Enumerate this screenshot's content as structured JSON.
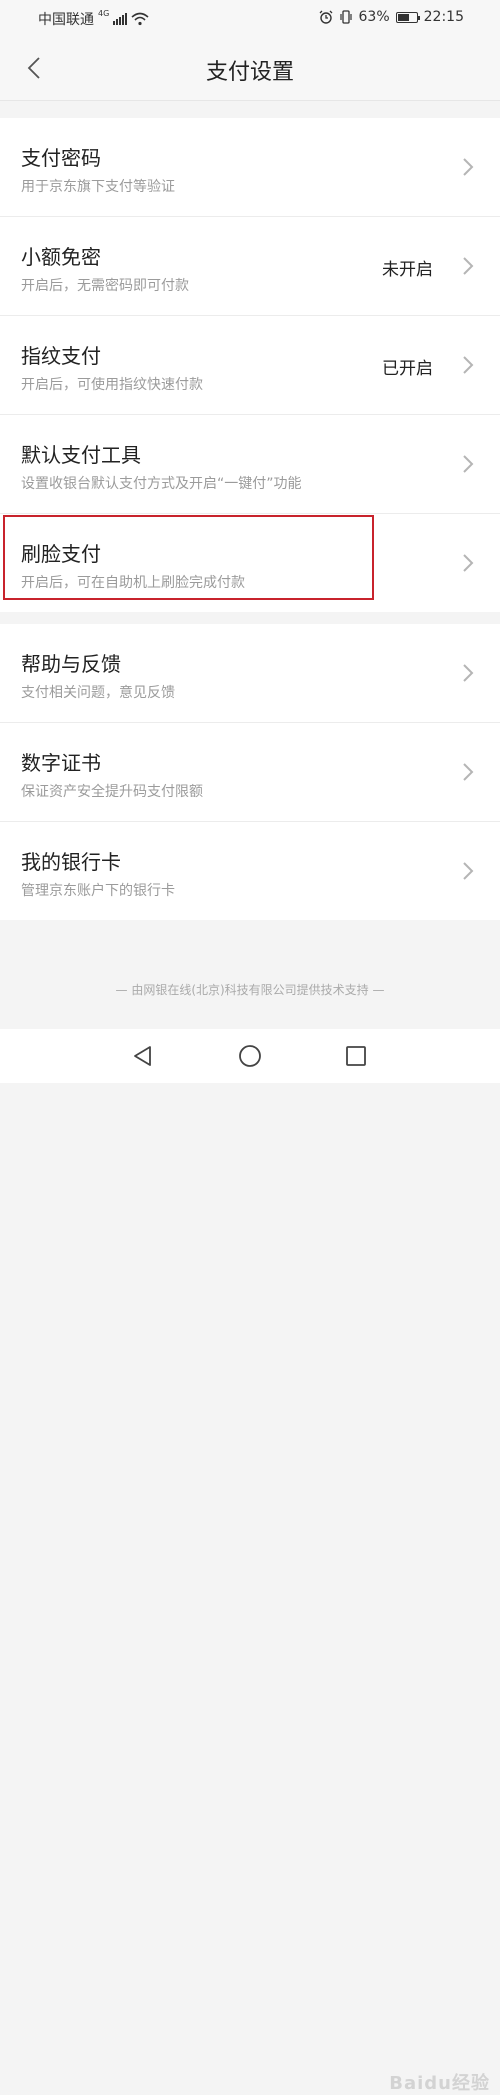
{
  "status": {
    "carrier": "中国联通",
    "network": "4G",
    "battery": "63%",
    "battery_level": 0.63,
    "time": "22:15"
  },
  "header": {
    "title": "支付设置"
  },
  "groups": [
    {
      "items": [
        {
          "title": "支付密码",
          "subtitle": "用于京东旗下支付等验证",
          "value": ""
        },
        {
          "title": "小额免密",
          "subtitle": "开启后，无需密码即可付款",
          "value": "未开启"
        },
        {
          "title": "指纹支付",
          "subtitle": "开启后，可使用指纹快速付款",
          "value": "已开启"
        },
        {
          "title": "默认支付工具",
          "subtitle": "设置收银台默认支付方式及开启“一键付”功能",
          "value": ""
        },
        {
          "title": "刷脸支付",
          "subtitle": "开启后，可在自助机上刷脸完成付款",
          "value": ""
        }
      ]
    },
    {
      "items": [
        {
          "title": "帮助与反馈",
          "subtitle": "支付相关问题，意见反馈",
          "value": ""
        },
        {
          "title": "数字证书",
          "subtitle": "保证资产安全提升码支付限额",
          "value": ""
        },
        {
          "title": "我的银行卡",
          "subtitle": "管理京东账户下的银行卡",
          "value": ""
        }
      ]
    }
  ],
  "footer": "— 由网银在线(北京)科技有限公司提供技术支持 —",
  "watermark": "Baidu经验",
  "colors": {
    "highlight": "#c8232c"
  }
}
